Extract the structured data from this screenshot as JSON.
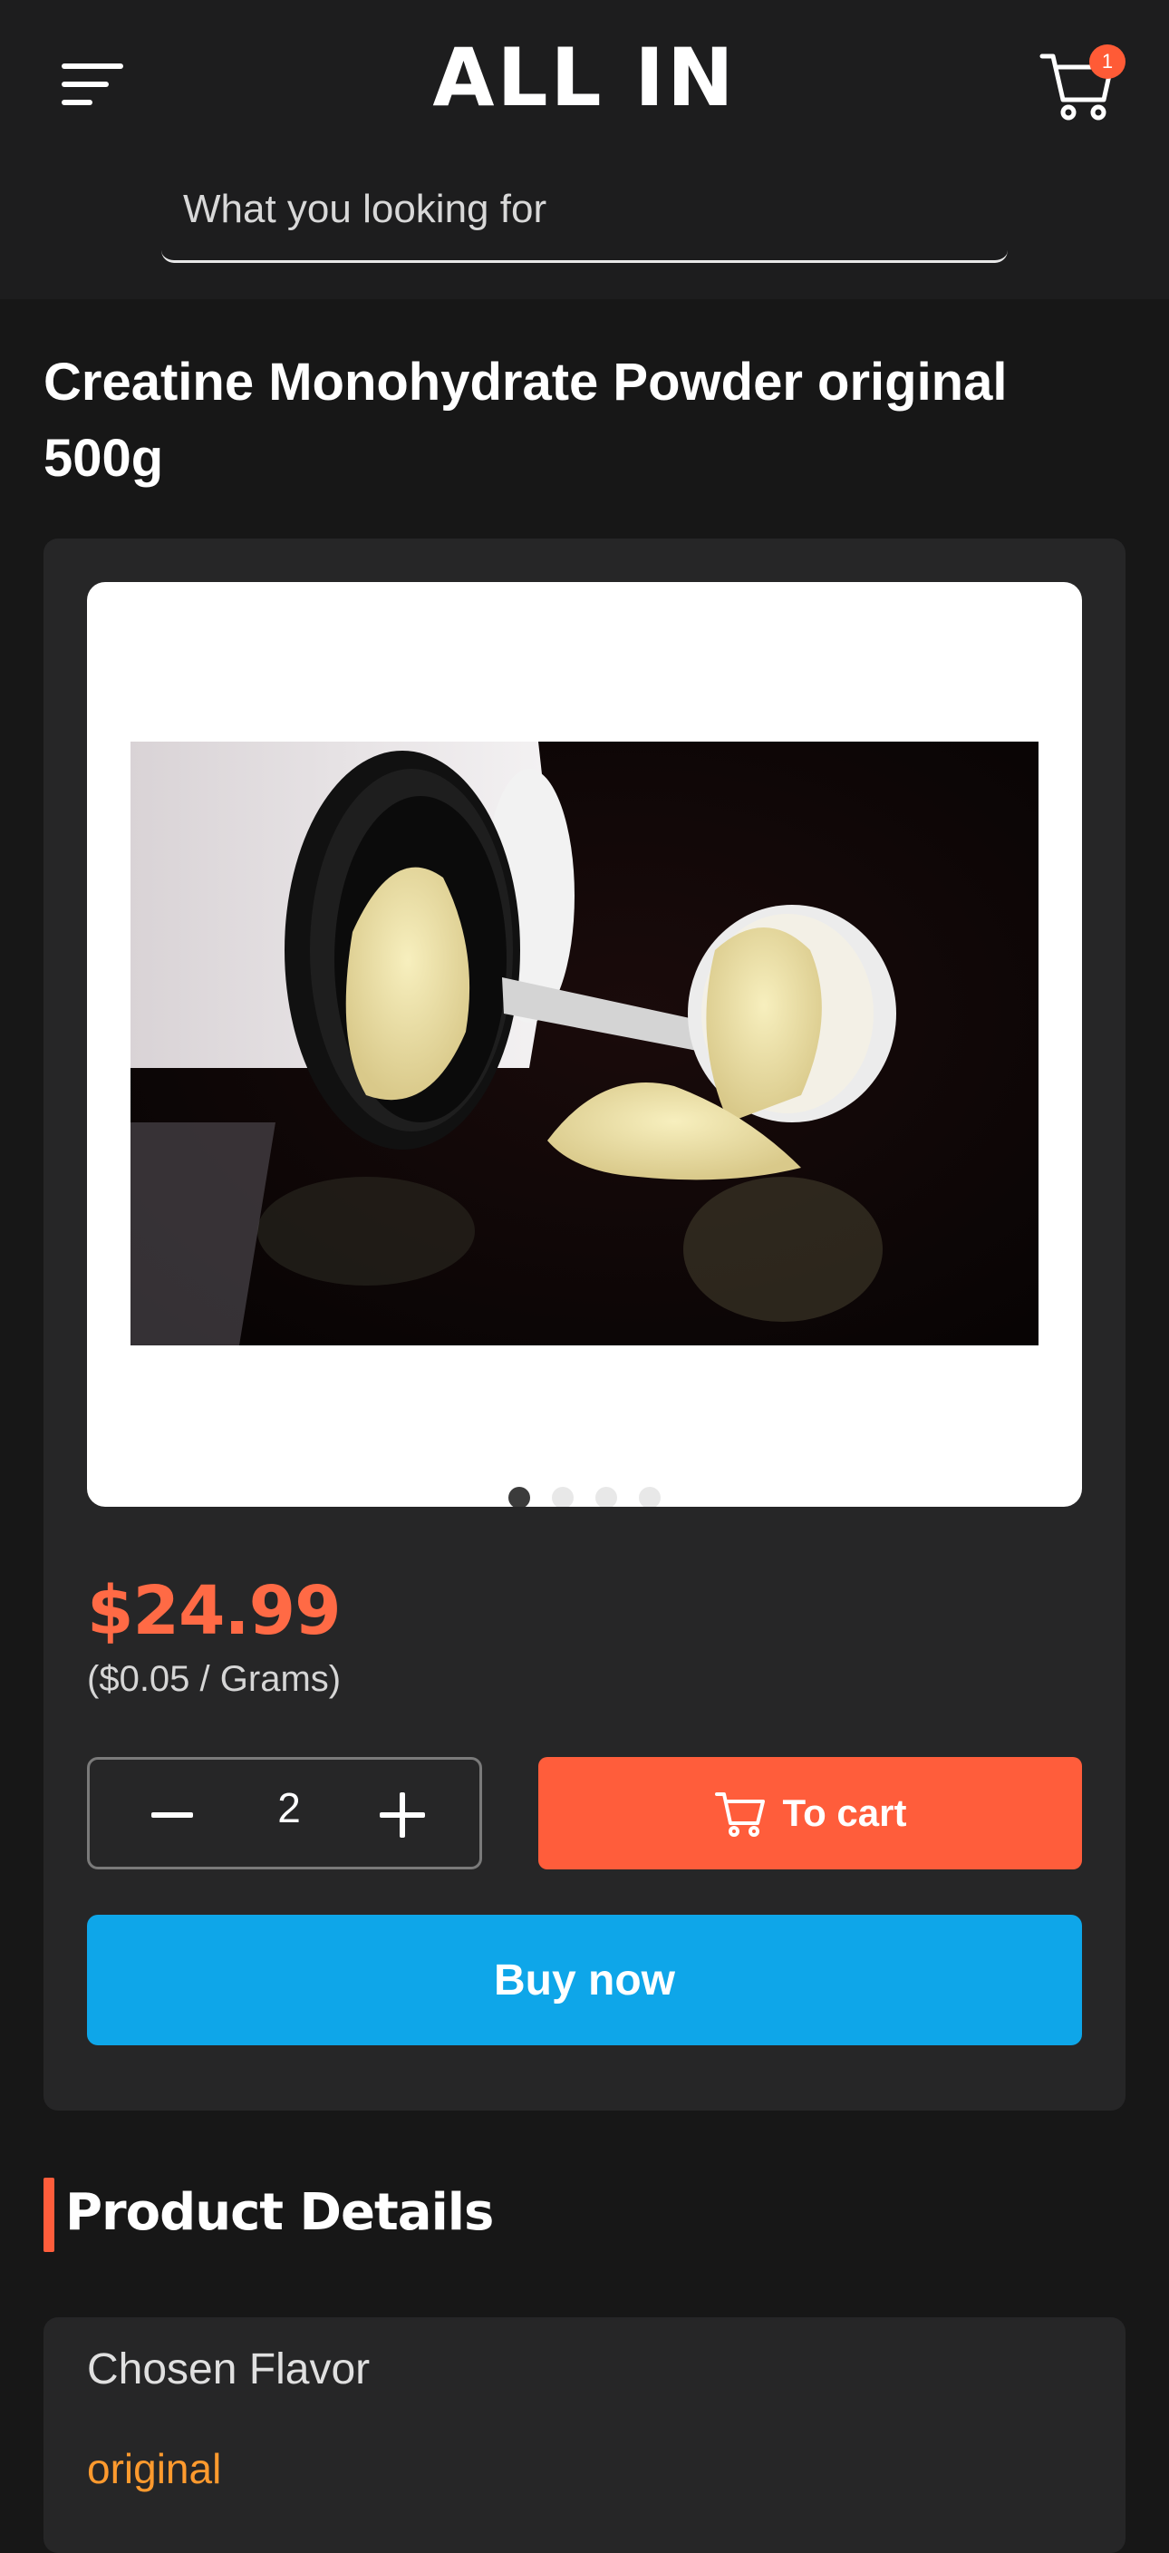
{
  "header": {
    "brand": "ALL IN",
    "cart_count": "1",
    "search_placeholder": "What you looking for"
  },
  "product": {
    "title": "Creatine Monohydrate Powder original 500g",
    "gallery": {
      "image_description": "Open tub of creatine powder with a scoop spilling powder on a dark surface",
      "slide_count": 4,
      "active_slide": 1
    },
    "price": "$24.99",
    "unit_price": "($0.05 / Grams)",
    "quantity": "2",
    "to_cart_label": "To cart",
    "buy_now_label": "Buy now"
  },
  "details": {
    "section_title": "Product Details",
    "flavor_label": "Chosen Flavor",
    "flavor_value": "original"
  },
  "colors": {
    "accent": "#ff5d3b",
    "buy_now": "#0ea6e9",
    "flavor": "#ff9a2e",
    "background": "#171717",
    "card": "#262627"
  },
  "icons": [
    "menu-icon",
    "cart-icon",
    "minus-icon",
    "plus-icon",
    "cart-small-icon"
  ]
}
